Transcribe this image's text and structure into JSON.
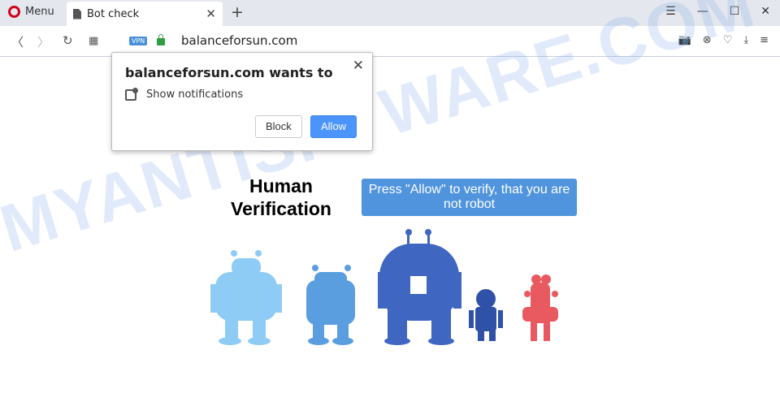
{
  "browser": {
    "menu_label": "Menu",
    "tab_title": "Bot check",
    "url": "balanceforsun.com",
    "vpn_badge": "VPN"
  },
  "popup": {
    "title": "balanceforsun.com wants to",
    "permission": "Show notifications",
    "block_label": "Block",
    "allow_label": "Allow",
    "close_icon": "close-icon"
  },
  "page": {
    "heading_line1": "Human",
    "heading_line2": "Verification",
    "message": "Press \"Allow\" to verify, that you are not robot",
    "watermark": "MYANTISPYWARE.COM"
  },
  "colors": {
    "robot1": "#8ecbf5",
    "robot2": "#5a9ee0",
    "robot3": "#3f66c0",
    "robot4": "#2f52a8",
    "robot5": "#e85a5f",
    "allow": "#4b94fa"
  }
}
